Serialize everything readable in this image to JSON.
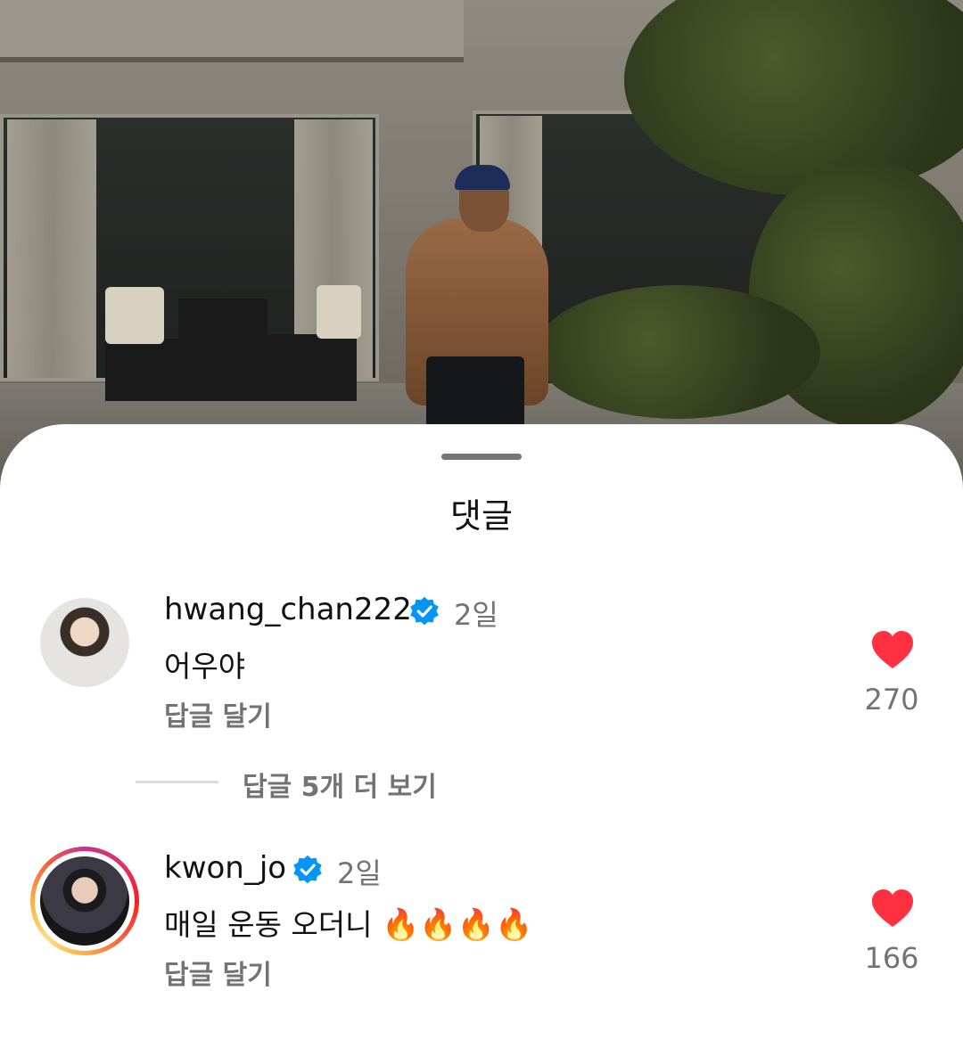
{
  "sheet": {
    "title": "댓글"
  },
  "comments": [
    {
      "username": "hwang_chan222",
      "verified": true,
      "time": "2일",
      "text": "어우야",
      "reply_label": "답글 달기",
      "likes": "270",
      "avatar_icon": "avatar-photo",
      "has_story_ring": false
    },
    {
      "username": "kwon_jo",
      "verified": true,
      "time": "2일",
      "text": "매일 운동 오더니",
      "emoji": "🔥🔥🔥🔥",
      "reply_label": "답글 달기",
      "likes": "166",
      "avatar_icon": "avatar-photo",
      "has_story_ring": true
    }
  ],
  "more_replies": "답글 5개 더 보기",
  "colors": {
    "heart": "#ff3040",
    "verified": "#0095f6",
    "secondary_text": "#737373"
  }
}
